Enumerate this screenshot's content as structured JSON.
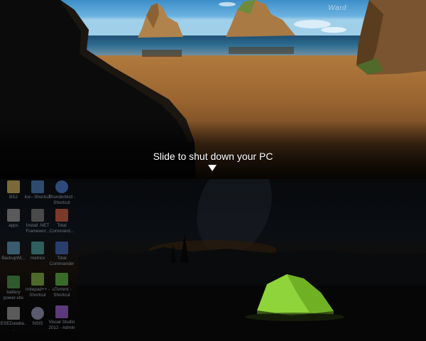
{
  "lock_screen": {
    "watermark": "Ward",
    "slide_text": "Slide to shut down your PC",
    "arrow_icon": "arrow-down-icon"
  },
  "desktop": {
    "icons": [
      {
        "label": "BS2",
        "icon": "folder-icon"
      },
      {
        "label": "apps",
        "icon": "document-icon"
      },
      {
        "label": "BackupWi...",
        "icon": "app-icon"
      },
      {
        "label": "battery power.vbs",
        "icon": "battery-icon"
      },
      {
        "label": "ESEDataba...",
        "icon": "document-icon"
      },
      {
        "label": "Ice– Shortcut",
        "icon": "app-icon"
      },
      {
        "label": "Install .NET Framewor...",
        "icon": "installer-icon"
      },
      {
        "label": "metrics",
        "icon": "app-icon"
      },
      {
        "label": "notepad++ - Shortcut",
        "icon": "notepad-icon"
      },
      {
        "label": "NSIS",
        "icon": "nsis-icon"
      },
      {
        "label": "Thunderbird - Shortcut",
        "icon": "thunderbird-icon"
      },
      {
        "label": "Total Command...",
        "icon": "total-commander-icon"
      },
      {
        "label": "Total Commander",
        "icon": "total-commander-icon"
      },
      {
        "label": "uTorrent - Shortcut",
        "icon": "utorrent-icon"
      },
      {
        "label": "Visual Studio 2012 - Admin",
        "icon": "visual-studio-icon"
      }
    ]
  },
  "colors": {
    "overlay_text": "#ffffff",
    "tent": "#8fd43a",
    "icon_label": "#6d7680"
  }
}
